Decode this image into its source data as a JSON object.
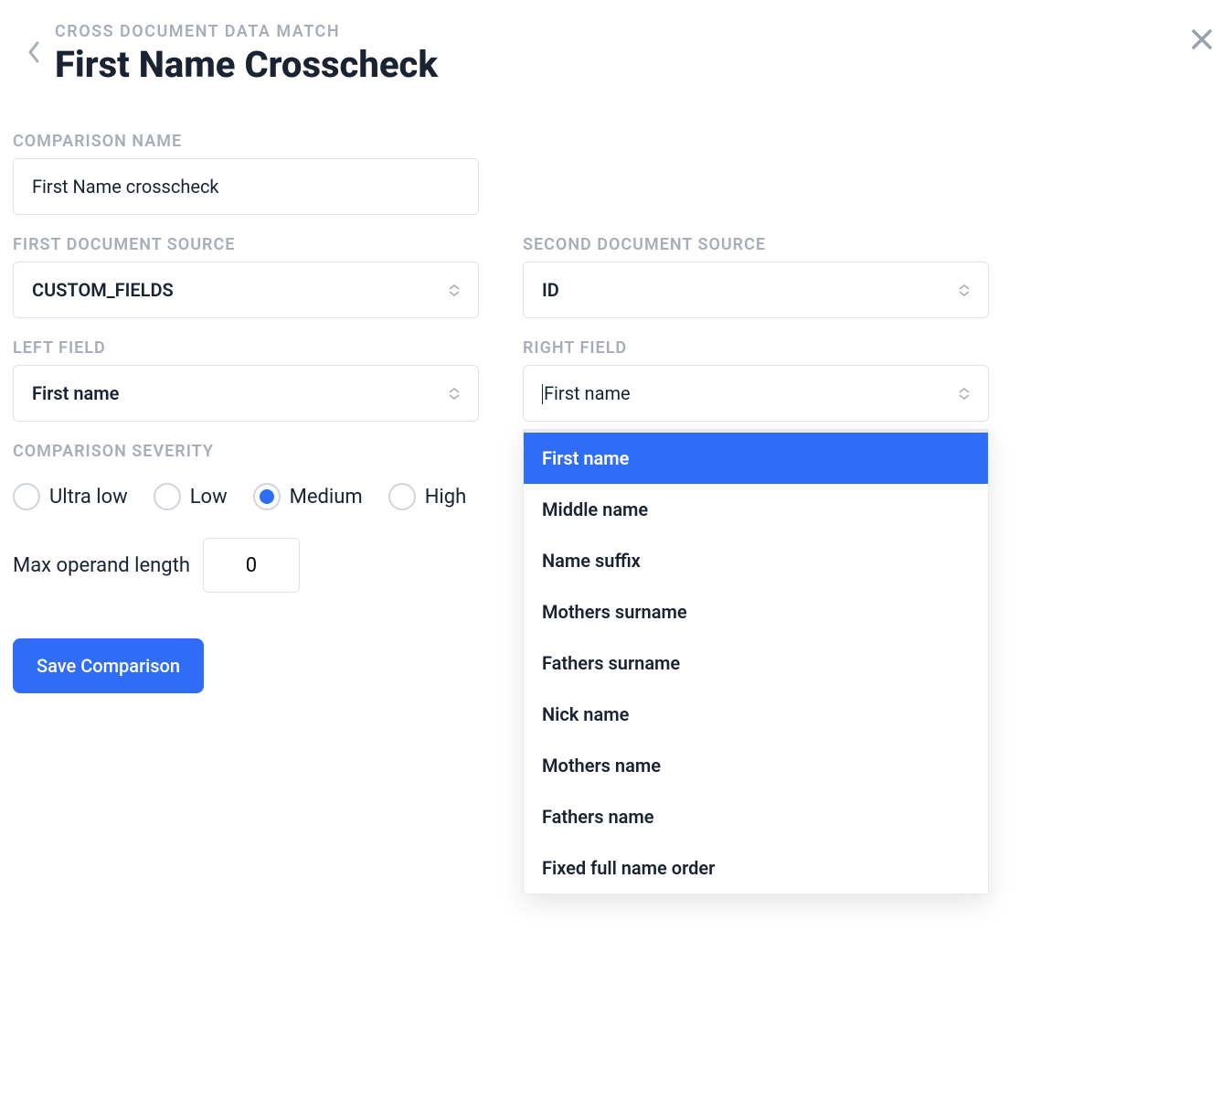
{
  "header": {
    "eyebrow": "CROSS DOCUMENT DATA MATCH",
    "title": "First Name Crosscheck"
  },
  "labels": {
    "comparison_name": "COMPARISON NAME",
    "first_doc_source": "FIRST DOCUMENT SOURCE",
    "second_doc_source": "SECOND DOCUMENT SOURCE",
    "left_field": "LEFT FIELD",
    "right_field": "RIGHT FIELD",
    "severity": "COMPARISON SEVERITY",
    "max_operand": "Max operand length"
  },
  "form": {
    "comparison_name_value": "First Name crosscheck",
    "first_doc_source_value": "CUSTOM_FIELDS",
    "second_doc_source_value": "ID",
    "left_field_value": "First name",
    "right_field_value": "First name",
    "max_operand_value": "0"
  },
  "severity_options": [
    {
      "label": "Ultra low",
      "selected": false
    },
    {
      "label": "Low",
      "selected": false
    },
    {
      "label": "Medium",
      "selected": true
    },
    {
      "label": "High",
      "selected": false
    }
  ],
  "right_field_dropdown": {
    "options": [
      "First name",
      "Middle name",
      "Name suffix",
      "Mothers surname",
      "Fathers surname",
      "Nick name",
      "Mothers name",
      "Fathers name",
      "Fixed full name order"
    ],
    "highlighted_index": 0
  },
  "buttons": {
    "save": "Save Comparison"
  }
}
